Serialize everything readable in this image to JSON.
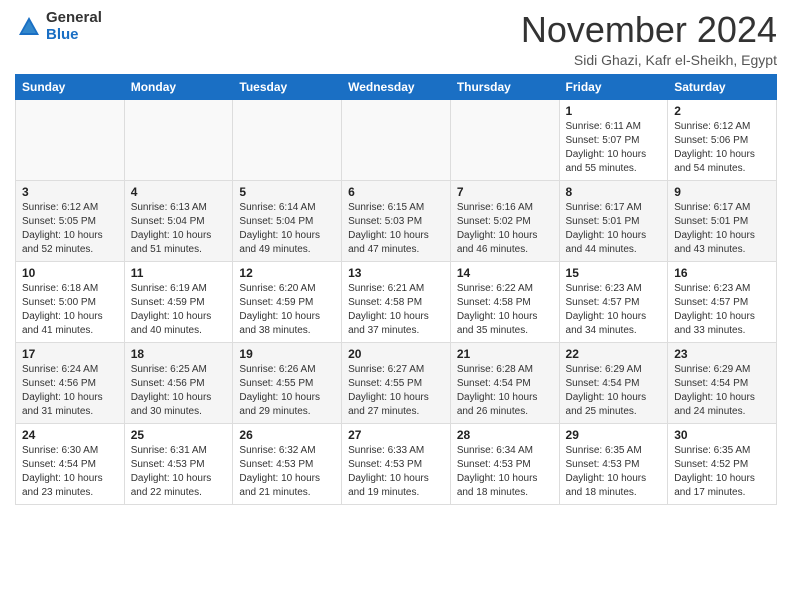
{
  "logo": {
    "general": "General",
    "blue": "Blue"
  },
  "title": "November 2024",
  "location": "Sidi Ghazi, Kafr el-Sheikh, Egypt",
  "days_of_week": [
    "Sunday",
    "Monday",
    "Tuesday",
    "Wednesday",
    "Thursday",
    "Friday",
    "Saturday"
  ],
  "weeks": [
    [
      {
        "day": "",
        "info": ""
      },
      {
        "day": "",
        "info": ""
      },
      {
        "day": "",
        "info": ""
      },
      {
        "day": "",
        "info": ""
      },
      {
        "day": "",
        "info": ""
      },
      {
        "day": "1",
        "info": "Sunrise: 6:11 AM\nSunset: 5:07 PM\nDaylight: 10 hours\nand 55 minutes."
      },
      {
        "day": "2",
        "info": "Sunrise: 6:12 AM\nSunset: 5:06 PM\nDaylight: 10 hours\nand 54 minutes."
      }
    ],
    [
      {
        "day": "3",
        "info": "Sunrise: 6:12 AM\nSunset: 5:05 PM\nDaylight: 10 hours\nand 52 minutes."
      },
      {
        "day": "4",
        "info": "Sunrise: 6:13 AM\nSunset: 5:04 PM\nDaylight: 10 hours\nand 51 minutes."
      },
      {
        "day": "5",
        "info": "Sunrise: 6:14 AM\nSunset: 5:04 PM\nDaylight: 10 hours\nand 49 minutes."
      },
      {
        "day": "6",
        "info": "Sunrise: 6:15 AM\nSunset: 5:03 PM\nDaylight: 10 hours\nand 47 minutes."
      },
      {
        "day": "7",
        "info": "Sunrise: 6:16 AM\nSunset: 5:02 PM\nDaylight: 10 hours\nand 46 minutes."
      },
      {
        "day": "8",
        "info": "Sunrise: 6:17 AM\nSunset: 5:01 PM\nDaylight: 10 hours\nand 44 minutes."
      },
      {
        "day": "9",
        "info": "Sunrise: 6:17 AM\nSunset: 5:01 PM\nDaylight: 10 hours\nand 43 minutes."
      }
    ],
    [
      {
        "day": "10",
        "info": "Sunrise: 6:18 AM\nSunset: 5:00 PM\nDaylight: 10 hours\nand 41 minutes."
      },
      {
        "day": "11",
        "info": "Sunrise: 6:19 AM\nSunset: 4:59 PM\nDaylight: 10 hours\nand 40 minutes."
      },
      {
        "day": "12",
        "info": "Sunrise: 6:20 AM\nSunset: 4:59 PM\nDaylight: 10 hours\nand 38 minutes."
      },
      {
        "day": "13",
        "info": "Sunrise: 6:21 AM\nSunset: 4:58 PM\nDaylight: 10 hours\nand 37 minutes."
      },
      {
        "day": "14",
        "info": "Sunrise: 6:22 AM\nSunset: 4:58 PM\nDaylight: 10 hours\nand 35 minutes."
      },
      {
        "day": "15",
        "info": "Sunrise: 6:23 AM\nSunset: 4:57 PM\nDaylight: 10 hours\nand 34 minutes."
      },
      {
        "day": "16",
        "info": "Sunrise: 6:23 AM\nSunset: 4:57 PM\nDaylight: 10 hours\nand 33 minutes."
      }
    ],
    [
      {
        "day": "17",
        "info": "Sunrise: 6:24 AM\nSunset: 4:56 PM\nDaylight: 10 hours\nand 31 minutes."
      },
      {
        "day": "18",
        "info": "Sunrise: 6:25 AM\nSunset: 4:56 PM\nDaylight: 10 hours\nand 30 minutes."
      },
      {
        "day": "19",
        "info": "Sunrise: 6:26 AM\nSunset: 4:55 PM\nDaylight: 10 hours\nand 29 minutes."
      },
      {
        "day": "20",
        "info": "Sunrise: 6:27 AM\nSunset: 4:55 PM\nDaylight: 10 hours\nand 27 minutes."
      },
      {
        "day": "21",
        "info": "Sunrise: 6:28 AM\nSunset: 4:54 PM\nDaylight: 10 hours\nand 26 minutes."
      },
      {
        "day": "22",
        "info": "Sunrise: 6:29 AM\nSunset: 4:54 PM\nDaylight: 10 hours\nand 25 minutes."
      },
      {
        "day": "23",
        "info": "Sunrise: 6:29 AM\nSunset: 4:54 PM\nDaylight: 10 hours\nand 24 minutes."
      }
    ],
    [
      {
        "day": "24",
        "info": "Sunrise: 6:30 AM\nSunset: 4:54 PM\nDaylight: 10 hours\nand 23 minutes."
      },
      {
        "day": "25",
        "info": "Sunrise: 6:31 AM\nSunset: 4:53 PM\nDaylight: 10 hours\nand 22 minutes."
      },
      {
        "day": "26",
        "info": "Sunrise: 6:32 AM\nSunset: 4:53 PM\nDaylight: 10 hours\nand 21 minutes."
      },
      {
        "day": "27",
        "info": "Sunrise: 6:33 AM\nSunset: 4:53 PM\nDaylight: 10 hours\nand 19 minutes."
      },
      {
        "day": "28",
        "info": "Sunrise: 6:34 AM\nSunset: 4:53 PM\nDaylight: 10 hours\nand 18 minutes."
      },
      {
        "day": "29",
        "info": "Sunrise: 6:35 AM\nSunset: 4:53 PM\nDaylight: 10 hours\nand 18 minutes."
      },
      {
        "day": "30",
        "info": "Sunrise: 6:35 AM\nSunset: 4:52 PM\nDaylight: 10 hours\nand 17 minutes."
      }
    ]
  ]
}
